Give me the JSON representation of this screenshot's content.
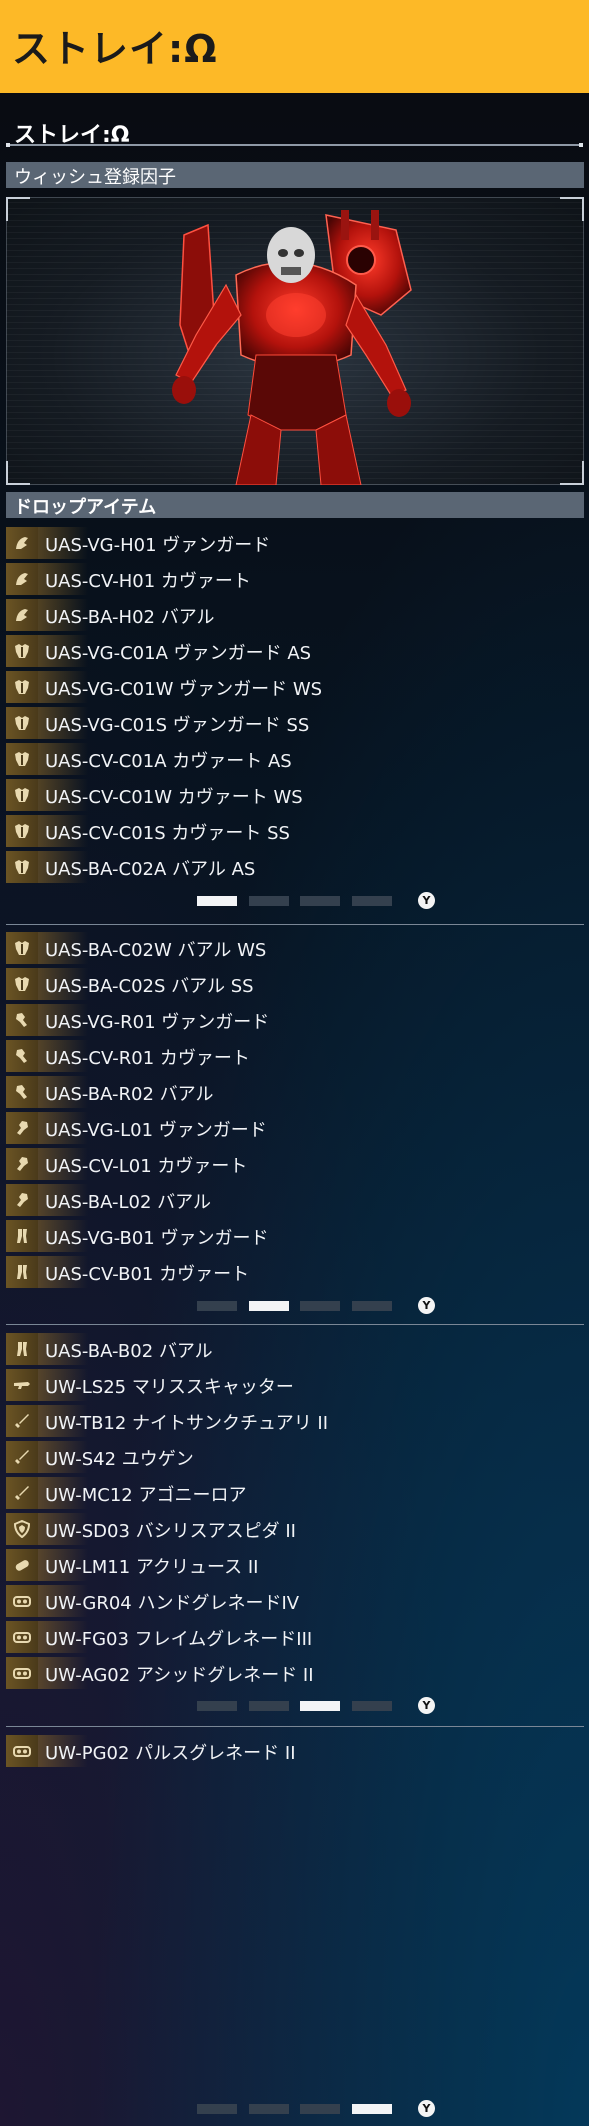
{
  "header": {
    "title": "ストレイ:Ω"
  },
  "subtitle": "ストレイ:Ω",
  "sections": {
    "wish": "ウィッシュ登録因子",
    "drops": "ドロップアイテム"
  },
  "pages": [
    {
      "items": [
        {
          "icon": "helmet-icon",
          "label": "UAS-VG-H01 ヴァンガード"
        },
        {
          "icon": "helmet-icon",
          "label": "UAS-CV-H01 カヴァート"
        },
        {
          "icon": "helmet-icon",
          "label": "UAS-BA-H02 バアル"
        },
        {
          "icon": "chest-armor-icon",
          "label": "UAS-VG-C01A ヴァンガード AS"
        },
        {
          "icon": "chest-armor-icon",
          "label": "UAS-VG-C01W ヴァンガード WS"
        },
        {
          "icon": "chest-armor-icon",
          "label": "UAS-VG-C01S ヴァンガード SS"
        },
        {
          "icon": "chest-armor-icon",
          "label": "UAS-CV-C01A カヴァート AS"
        },
        {
          "icon": "chest-armor-icon",
          "label": "UAS-CV-C01W カヴァート WS"
        },
        {
          "icon": "chest-armor-icon",
          "label": "UAS-CV-C01S カヴァート SS"
        },
        {
          "icon": "chest-armor-icon",
          "label": "UAS-BA-C02A バアル AS"
        }
      ],
      "active_dot": 0
    },
    {
      "items": [
        {
          "icon": "chest-armor-icon",
          "label": "UAS-BA-C02W バアル WS"
        },
        {
          "icon": "chest-armor-icon",
          "label": "UAS-BA-C02S バアル SS"
        },
        {
          "icon": "right-arm-icon",
          "label": "UAS-VG-R01 ヴァンガード"
        },
        {
          "icon": "right-arm-icon",
          "label": "UAS-CV-R01 カヴァート"
        },
        {
          "icon": "right-arm-icon",
          "label": "UAS-BA-R02 バアル"
        },
        {
          "icon": "left-arm-icon",
          "label": "UAS-VG-L01 ヴァンガード"
        },
        {
          "icon": "left-arm-icon",
          "label": "UAS-CV-L01 カヴァート"
        },
        {
          "icon": "left-arm-icon",
          "label": "UAS-BA-L02 バアル"
        },
        {
          "icon": "legs-icon",
          "label": "UAS-VG-B01 ヴァンガード"
        },
        {
          "icon": "legs-icon",
          "label": "UAS-CV-B01 カヴァート"
        }
      ],
      "active_dot": 1
    },
    {
      "items": [
        {
          "icon": "legs-icon",
          "label": "UAS-BA-B02 バアル"
        },
        {
          "icon": "gun-icon",
          "label": "UW-LS25 マリススキャッター"
        },
        {
          "icon": "sword-icon",
          "label": "UW-TB12 ナイトサンクチュアリ II"
        },
        {
          "icon": "sword-icon",
          "label": "UW-S42 ユウゲン"
        },
        {
          "icon": "sword-icon",
          "label": "UW-MC12 アゴニーロア"
        },
        {
          "icon": "shield-icon",
          "label": "UW-SD03 バシリスアスピダ II"
        },
        {
          "icon": "capsule-icon",
          "label": "UW-LM11 アクリュース II"
        },
        {
          "icon": "grenade-icon",
          "label": "UW-GR04 ハンドグレネードIV"
        },
        {
          "icon": "grenade-icon",
          "label": "UW-FG03 フレイムグレネードIII"
        },
        {
          "icon": "grenade-icon",
          "label": "UW-AG02 アシッドグレネード II"
        }
      ],
      "active_dot": 2
    },
    {
      "items": [
        {
          "icon": "grenade-icon",
          "label": "UW-PG02 パルスグレネード II"
        }
      ],
      "active_dot": 3
    }
  ],
  "pager": {
    "button": "Y",
    "dot_count": 4
  },
  "colors": {
    "header_bg": "#fdb927",
    "section_bar": "#5a6674",
    "icon_bg": "#6b5424",
    "dot_active": "#f3f4f6",
    "dot_inactive": "#34404e"
  }
}
